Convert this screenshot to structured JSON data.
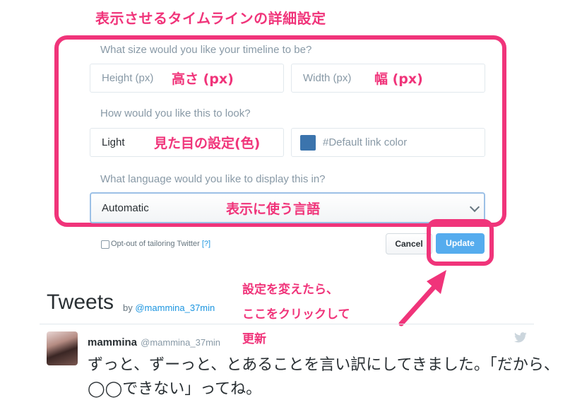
{
  "annotations": {
    "title": "表示させるタイムラインの詳細設定",
    "height_note": "高さ (px)",
    "width_note": "幅 (px)",
    "look_note": "見た目の設定(色)",
    "language_note": "表示に使う言語",
    "update_note_lines": [
      "設定を変えたら、",
      "ここをクリックして",
      "更新"
    ]
  },
  "form": {
    "size_question": "What size would you like your timeline to be?",
    "height_placeholder": "Height (px)",
    "width_placeholder": "Width (px)",
    "look_question": "How would you like this to look?",
    "theme_value": "Light",
    "link_color_placeholder": "#Default link color",
    "link_color_swatch": "#3b74ad",
    "language_question": "What language would you like to display this in?",
    "language_value": "Automatic",
    "optout_label": "Opt-out of tailoring Twitter",
    "optout_help": "[?]",
    "optout_checked": false,
    "cancel_label": "Cancel",
    "update_label": "Update"
  },
  "timeline": {
    "heading": "Tweets",
    "by_prefix": "by",
    "by_handle": "@mammina_37min",
    "tweet": {
      "name": "mammina",
      "handle": "@mammina_37min",
      "text": "ずっと、ずーっと、とあることを言い訳にしてきました。「だから、◯◯できない」ってね。"
    }
  },
  "colors": {
    "annotation": "#f0347a",
    "twitter_blue": "#55acee"
  }
}
